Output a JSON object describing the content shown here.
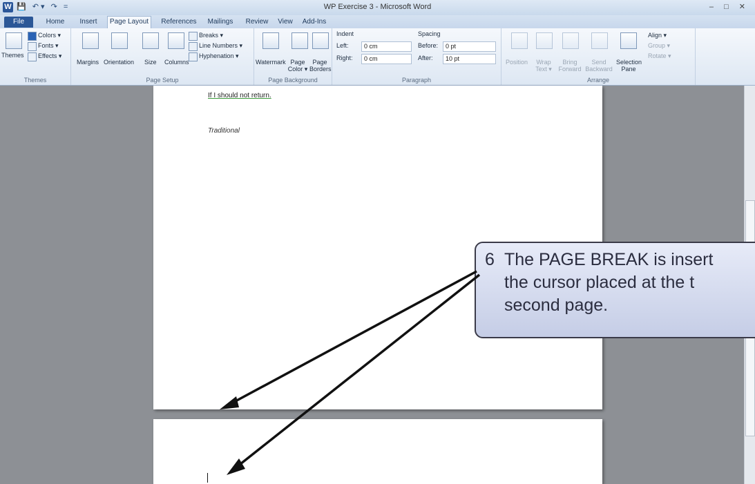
{
  "window": {
    "title": "WP Exercise 3 - Microsoft Word",
    "app_icon": "W",
    "controls": "– □ ✕"
  },
  "qat": [
    "💾",
    "↶ ▾",
    "↷",
    "="
  ],
  "tabs": [
    "File",
    "Home",
    "Insert",
    "Page Layout",
    "References",
    "Mailings",
    "Review",
    "View",
    "Add-Ins"
  ],
  "ribbon": {
    "themes": {
      "group": "Themes",
      "themes": "Themes",
      "colors": "Colors ▾",
      "fonts": "Fonts ▾",
      "effects": "Effects ▾"
    },
    "page_setup": {
      "group": "Page Setup",
      "margins": "Margins",
      "orientation": "Orientation",
      "size": "Size",
      "columns": "Columns",
      "breaks": "Breaks ▾",
      "line_numbers": "Line Numbers ▾",
      "hyphenation": "Hyphenation ▾"
    },
    "page_background": {
      "group": "Page Background",
      "watermark": "Watermark",
      "page_color": "Page Color ▾",
      "page_borders": "Page Borders"
    },
    "paragraph": {
      "group": "Paragraph",
      "indent": "Indent",
      "left": "Left:",
      "left_value": "0 cm",
      "right": "Right:",
      "right_value": "0 cm",
      "spacing": "Spacing",
      "before": "Before:",
      "before_value": "0 pt",
      "after": "After:",
      "after_value": "10 pt"
    },
    "arrange": {
      "group": "Arrange",
      "position": "Position",
      "wrap_text": "Wrap Text ▾",
      "bring_forward": "Bring Forward",
      "send_backward": "Send Backward",
      "selection_pane": "Selection Pane",
      "align": "Align ▾",
      "group_btn": "Group ▾",
      "rotate": "Rotate ▾"
    }
  },
  "document": {
    "line1": "If I should not return.",
    "line2": "Traditional"
  },
  "callout": {
    "number": "6",
    "line1": "The PAGE BREAK is insert",
    "line2": "the cursor placed at the t",
    "line3": "second page."
  }
}
